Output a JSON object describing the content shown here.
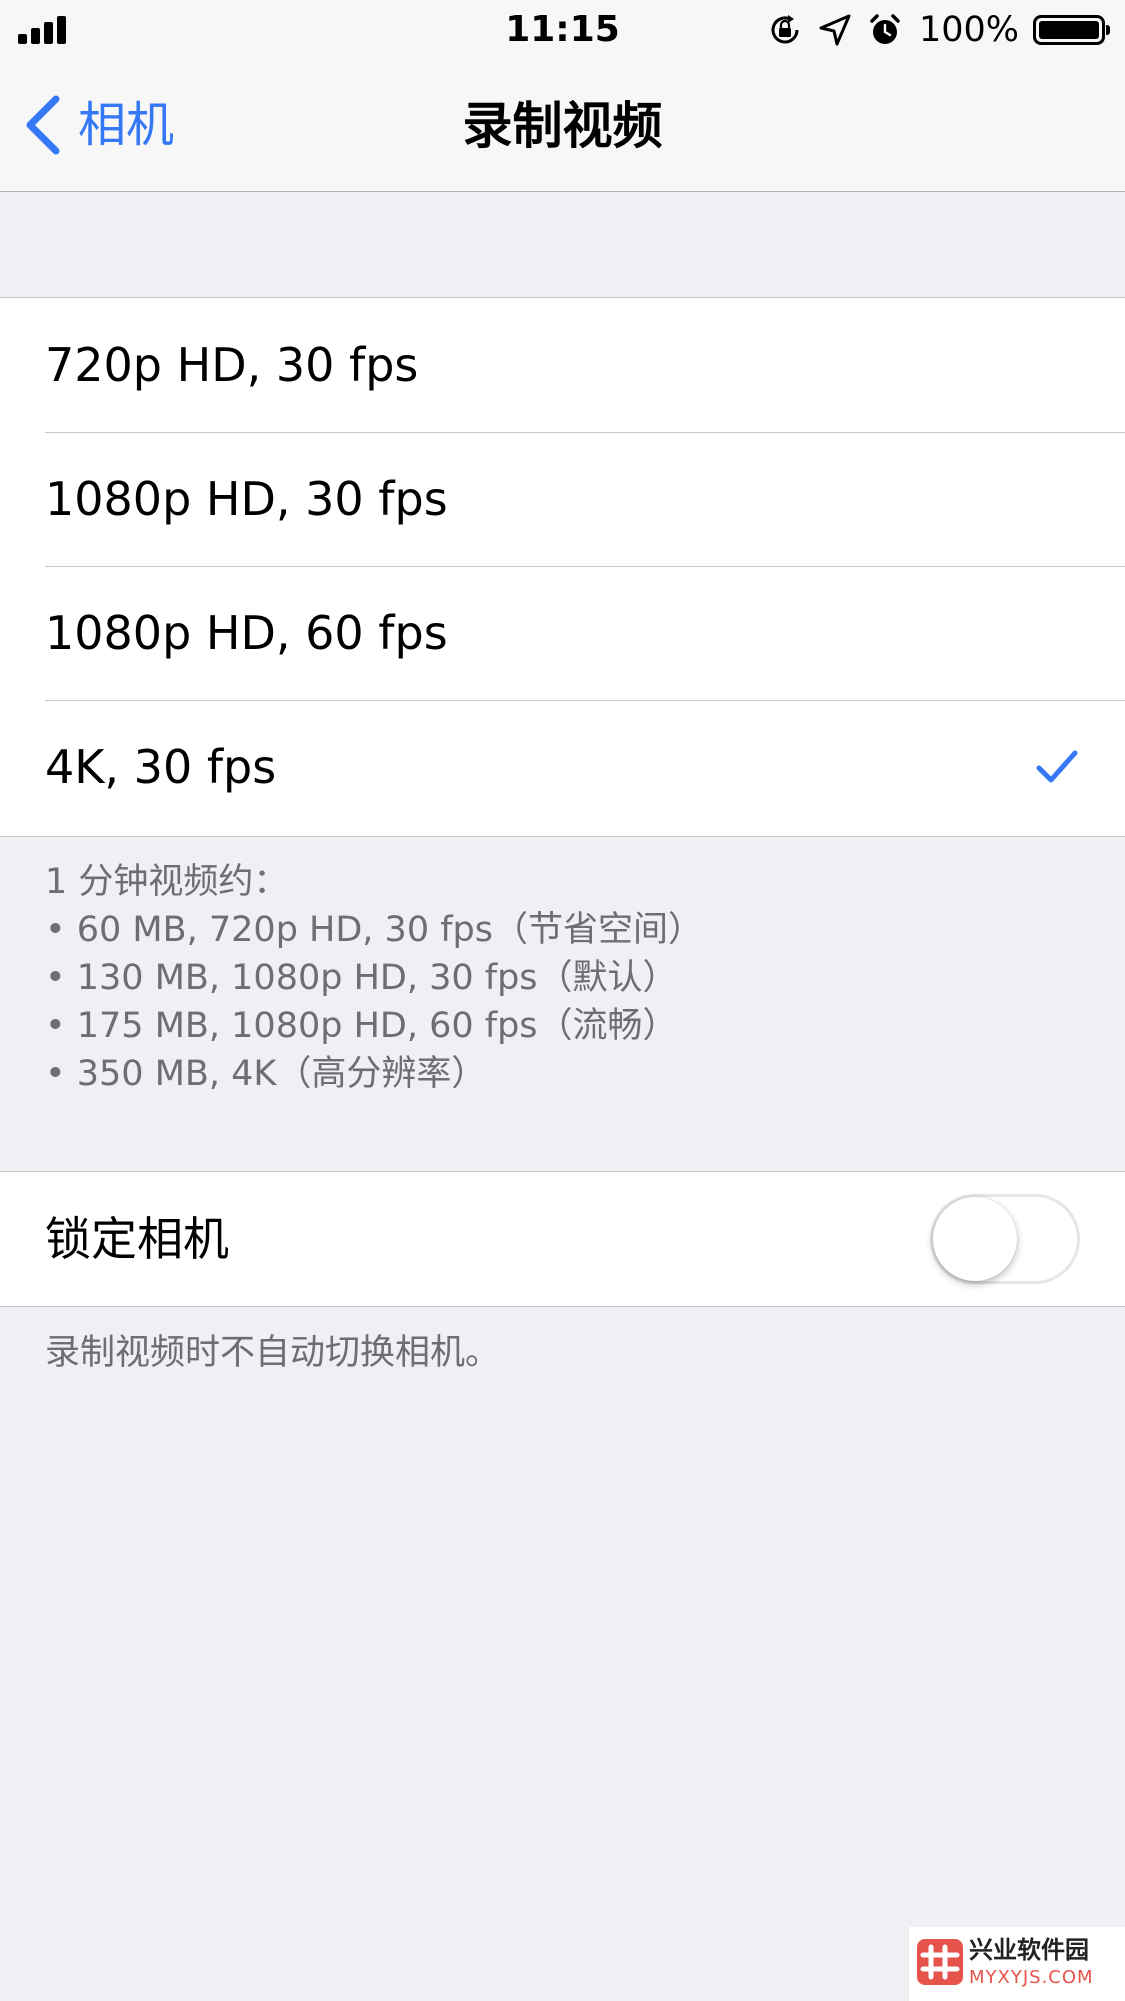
{
  "status_bar": {
    "time": "11:15",
    "battery_percent": "100%",
    "battery_level": 1.0,
    "icons": [
      "signal-icon",
      "orientation-lock-icon",
      "location-icon",
      "alarm-icon",
      "battery-icon"
    ]
  },
  "nav": {
    "back_label": "相机",
    "title": "录制视频"
  },
  "video_options": [
    {
      "label": "720p HD, 30 fps",
      "selected": false
    },
    {
      "label": "1080p HD, 30 fps",
      "selected": false
    },
    {
      "label": "1080p HD, 60 fps",
      "selected": false
    },
    {
      "label": "4K, 30 fps",
      "selected": true
    }
  ],
  "size_info": {
    "heading": "1 分钟视频约：",
    "lines": [
      "• 60 MB, 720p HD, 30 fps（节省空间）",
      "• 130 MB, 1080p HD, 30 fps（默认）",
      "• 175 MB, 1080p HD, 60 fps（流畅）",
      "• 350 MB, 4K（高分辨率）"
    ]
  },
  "lock_camera": {
    "label": "锁定相机",
    "enabled": false,
    "footer": "录制视频时不自动切换相机。"
  },
  "colors": {
    "accent": "#007aff",
    "background": "#efeff4",
    "separator": "#c8c7cc",
    "footer_text": "#6d6d72"
  },
  "watermark": {
    "name": "兴业软件园",
    "url": "MYXYJS.COM"
  }
}
